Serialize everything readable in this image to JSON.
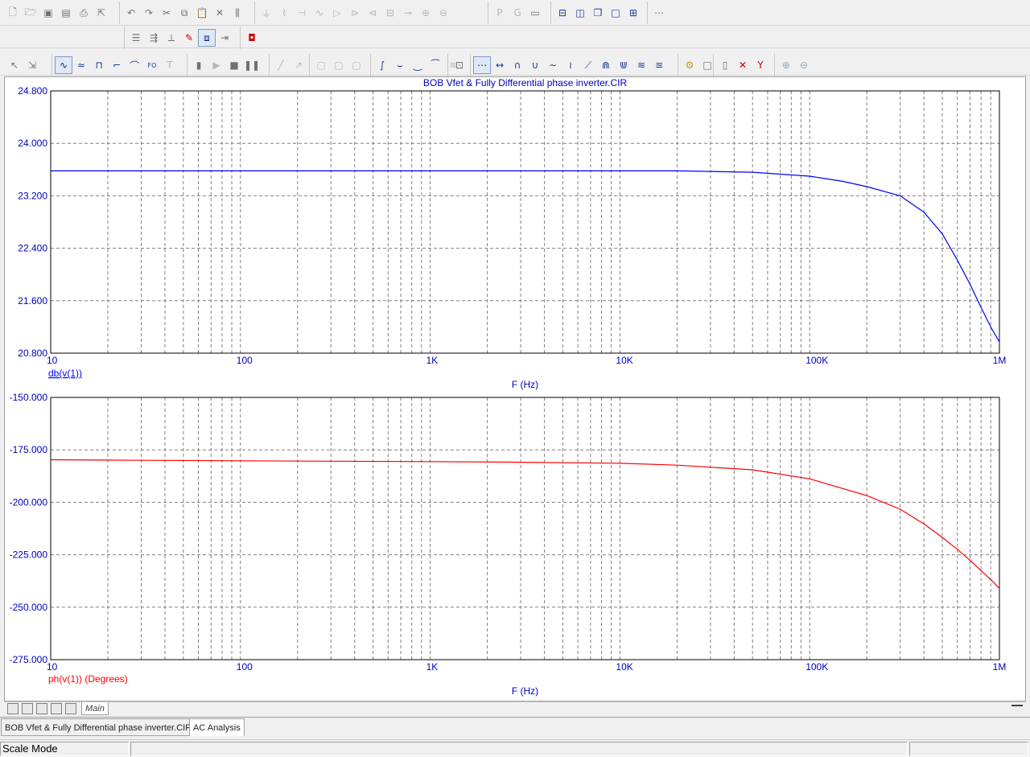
{
  "toolbar": {
    "row1": {
      "file": [
        "new-file-icon",
        "open-folder-icon",
        "save-icon",
        "save-as-icon",
        "print-icon",
        "export-icon"
      ],
      "edit": [
        "undo-icon",
        "redo-icon",
        "cut-icon",
        "copy-icon",
        "paste-icon",
        "delete-icon",
        "select-all-icon"
      ],
      "components": [
        "ground-icon",
        "resistor-icon",
        "capacitor-icon",
        "inductor-icon",
        "diode-icon",
        "npn-icon",
        "opamp-icon",
        "battery-icon",
        "switch-icon",
        "current-source-icon",
        "voltage-source-icon"
      ],
      "view": [
        "page-p-icon",
        "grid-g-icon",
        "window-icon"
      ],
      "layout": [
        "tile-horizontal-icon",
        "tile-vertical-icon",
        "cascade-icon",
        "maximize-icon",
        "split-icon"
      ],
      "extra": [
        "ruler-icon"
      ],
      "labels": {
        "p": "P",
        "g": "G"
      }
    },
    "row2": [
      "component-list-icon",
      "align-icon",
      "scale-icon",
      "pen-icon",
      "analysis-window-icon",
      "copy-window-icon",
      "stop-icon"
    ],
    "row3": [
      "pointer-icon",
      "select-icon",
      "waveform-icon",
      "sine-icon",
      "pulse-icon",
      "step-icon",
      "clock-icon",
      "fo-label-icon",
      "text-icon",
      "bar-icon",
      "run-icon",
      "stop-run-icon",
      "pause-icon",
      "line-icon",
      "arrow-icon",
      "box1-icon",
      "box2-icon",
      "box3-icon",
      "curve1-icon",
      "curve2-icon",
      "curve3-icon",
      "curve4-icon",
      "curve5-icon",
      "scope-icon",
      "dot-line-icon",
      "dot-line2-icon",
      "peak-icon",
      "valley-icon",
      "wave-icon",
      "wave2-icon",
      "slope-icon",
      "hump-icon",
      "hump2-icon",
      "stack-icon",
      "stack2-icon",
      "cursor-icon",
      "box-icon",
      "x-cursor-icon",
      "y-cursor-icon",
      "zoom-in-icon",
      "zoom-out-icon"
    ],
    "fo_label": "FO",
    "text_label": "T"
  },
  "chart_data": [
    {
      "type": "line",
      "title": "BOB Vfet & Fully Differential phase inverter.CIR",
      "series": [
        {
          "name": "db(v(1))",
          "color": "#0000ff",
          "x": [
            10,
            100,
            1000,
            10000,
            20000,
            50000,
            100000,
            150000,
            200000,
            300000,
            400000,
            500000,
            600000,
            700000,
            800000,
            900000,
            1000000
          ],
          "y": [
            23.58,
            23.58,
            23.58,
            23.58,
            23.58,
            23.56,
            23.5,
            23.42,
            23.34,
            23.2,
            22.95,
            22.62,
            22.22,
            21.85,
            21.5,
            21.2,
            20.97
          ]
        }
      ],
      "xlabel": "F (Hz)",
      "xscale": "log",
      "xlim": [
        10,
        1000000
      ],
      "ylim": [
        20.8,
        24.8
      ],
      "xticks": [
        "10",
        "100",
        "1K",
        "10K",
        "100K",
        "1M"
      ],
      "yticks": [
        "24.800",
        "24.000",
        "23.200",
        "22.400",
        "21.600",
        "20.800"
      ],
      "grid": true
    },
    {
      "type": "line",
      "series": [
        {
          "name": "ph(v(1)) (Degrees)",
          "color": "#ff0000",
          "x": [
            10,
            30,
            100,
            300,
            1000,
            3000,
            10000,
            20000,
            50000,
            100000,
            200000,
            300000,
            400000,
            500000,
            600000,
            700000,
            800000,
            900000,
            1000000
          ],
          "y": [
            -179.7,
            -180,
            -180.2,
            -180.4,
            -180.6,
            -180.9,
            -181.4,
            -182.3,
            -184.5,
            -188.8,
            -196.8,
            -203.3,
            -210.3,
            -216.7,
            -222.4,
            -227.6,
            -232.5,
            -236.8,
            -241
          ]
        }
      ],
      "xlabel": "F (Hz)",
      "xscale": "log",
      "xlim": [
        10,
        1000000
      ],
      "ylim": [
        -275,
        -150
      ],
      "xticks": [
        "10",
        "100",
        "1K",
        "10K",
        "100K",
        "1M"
      ],
      "yticks": [
        "-150.000",
        "-175.000",
        "-200.000",
        "-225.000",
        "-250.000",
        "-275.000"
      ],
      "grid": true
    }
  ],
  "tabs": {
    "main": "Main",
    "documents": [
      {
        "label": "BOB Vfet & Fully Differential phase inverter.CIR",
        "active": false
      },
      {
        "label": "AC Analysis",
        "active": true
      }
    ]
  },
  "status": {
    "mode": "Scale Mode"
  }
}
